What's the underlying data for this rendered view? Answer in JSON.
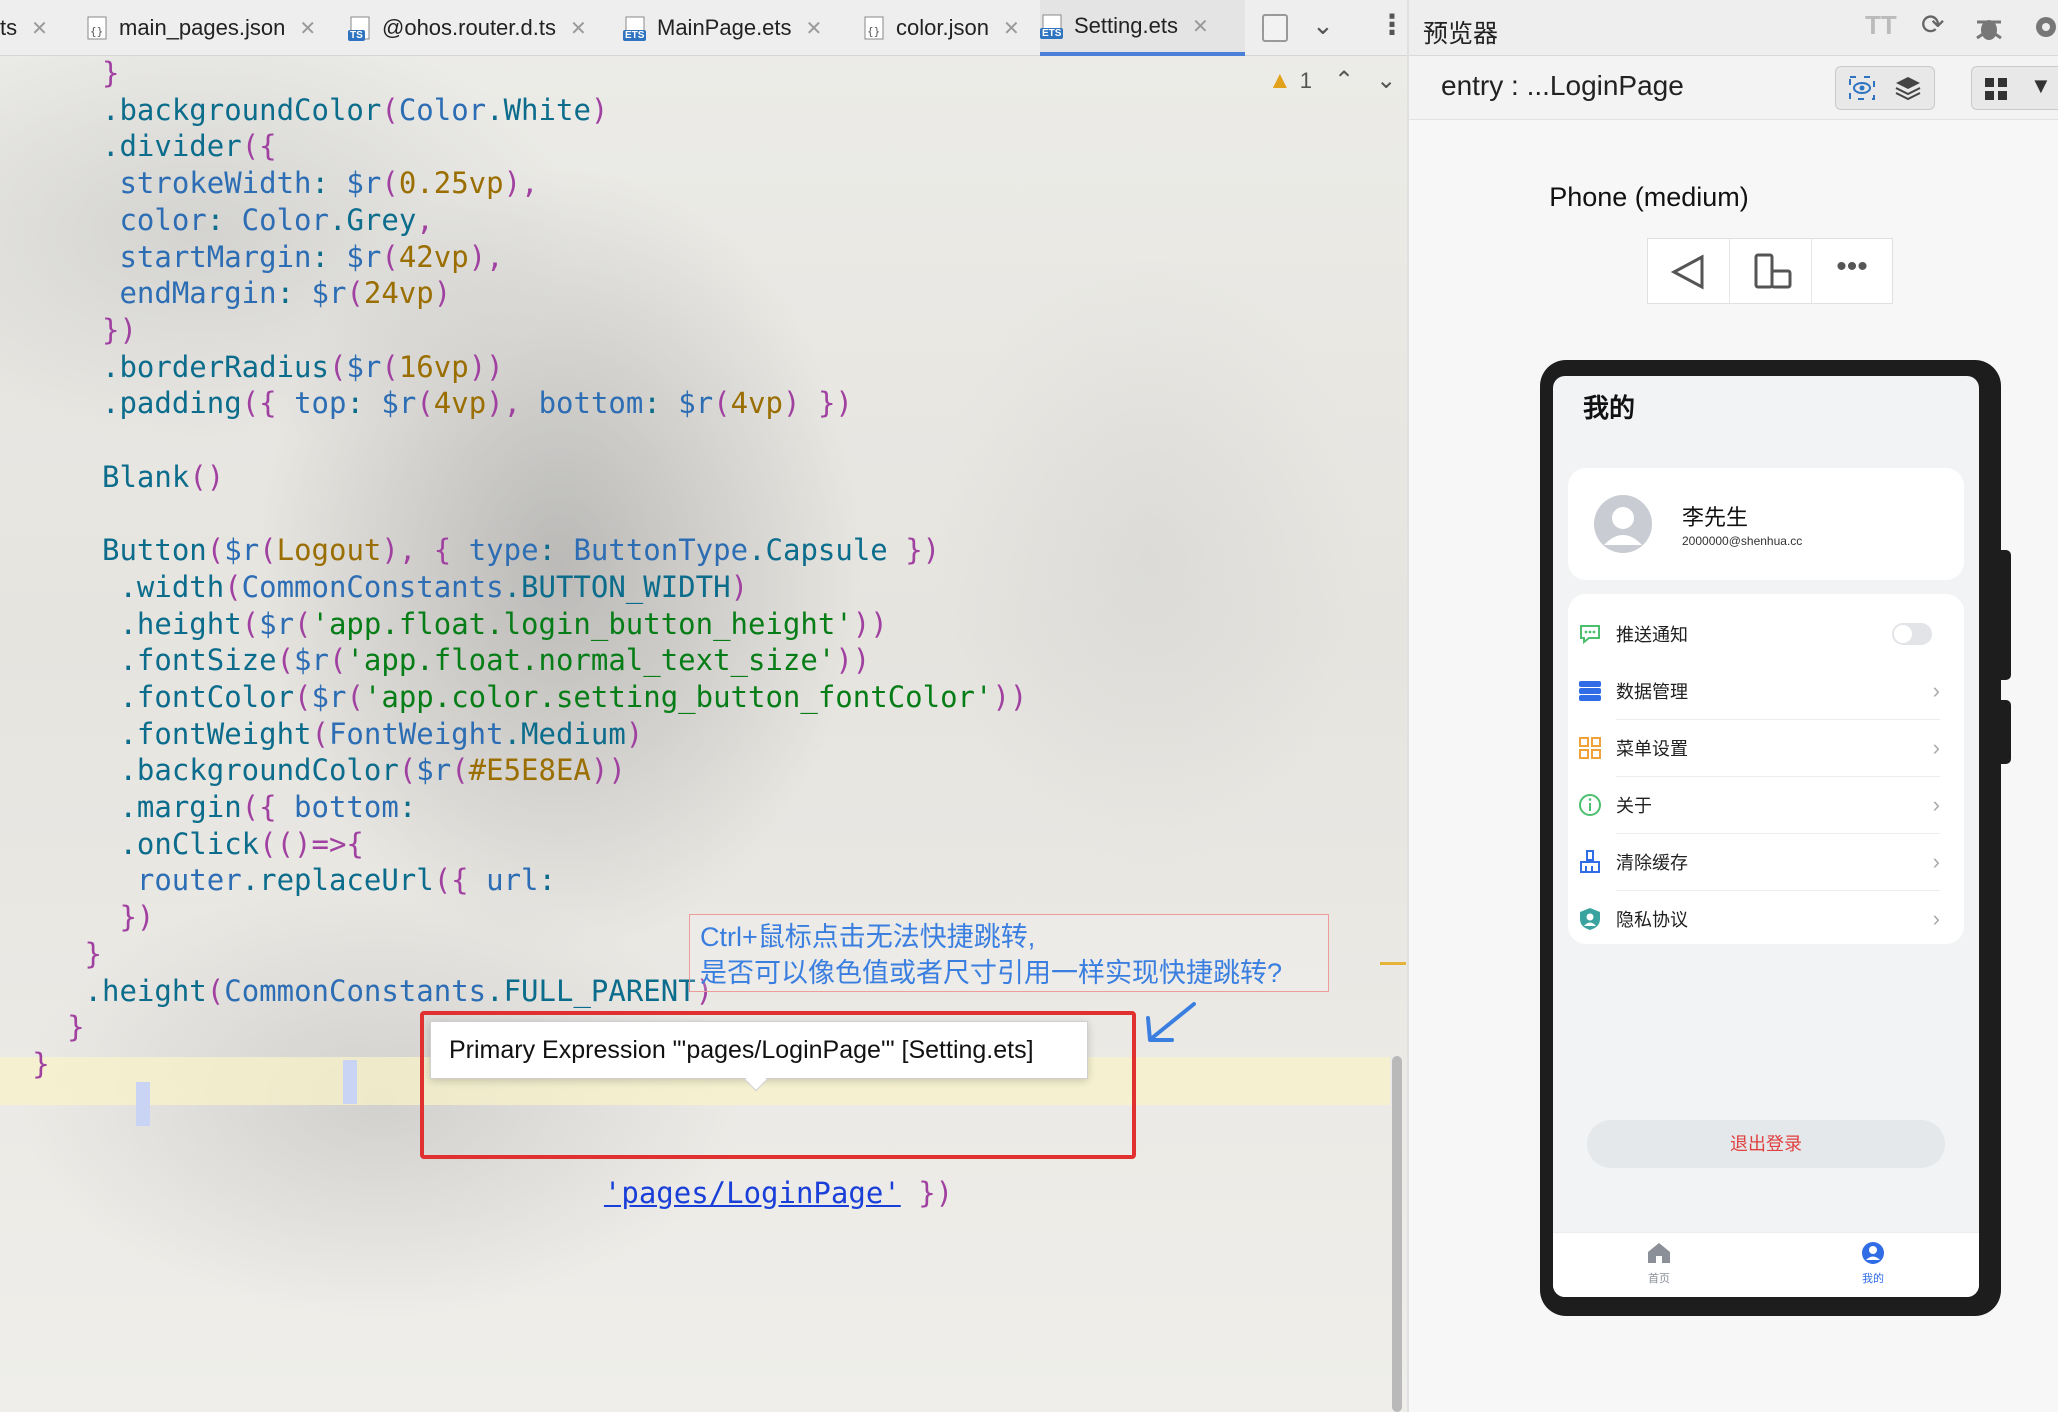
{
  "tabs": [
    {
      "label": "ts",
      "icon": "none"
    },
    {
      "label": "main_pages.json",
      "icon": "json-file-icon"
    },
    {
      "label": "@ohos.router.d.ts",
      "icon": "ts-file-icon"
    },
    {
      "label": "MainPage.ets",
      "icon": "ets-file-icon"
    },
    {
      "label": "color.json",
      "icon": "json-file-icon"
    },
    {
      "label": "Setting.ets",
      "icon": "ets-file-icon"
    }
  ],
  "tab_badges": {
    "ts": "TS",
    "ets": "ETS"
  },
  "editor": {
    "warning_count": "1",
    "lines": [
      {
        "indent": "    ",
        "parts": [
          [
            "o",
            "}"
          ]
        ]
      },
      {
        "indent": "    ",
        "parts": [
          [
            "m",
            ".backgroundColor"
          ],
          [
            "o",
            "("
          ],
          [
            "k",
            "Color"
          ],
          [
            "m",
            ".White"
          ],
          [
            "o",
            ")"
          ]
        ]
      },
      {
        "indent": "    ",
        "parts": [
          [
            "m",
            ".divider"
          ],
          [
            "o",
            "({"
          ]
        ]
      },
      {
        "indent": "     ",
        "parts": [
          [
            "k",
            "strokeWidth"
          ],
          [
            "m",
            ": "
          ],
          [
            "k",
            "$r"
          ],
          [
            "o",
            "("
          ],
          [
            "g",
            "0.25vp"
          ],
          [
            "o",
            "),"
          ]
        ]
      },
      {
        "indent": "     ",
        "parts": [
          [
            "k",
            "color"
          ],
          [
            "m",
            ": "
          ],
          [
            "k",
            "Color"
          ],
          [
            "m",
            ".Grey"
          ],
          [
            "o",
            ","
          ]
        ]
      },
      {
        "indent": "     ",
        "parts": [
          [
            "k",
            "startMargin"
          ],
          [
            "m",
            ": "
          ],
          [
            "k",
            "$r"
          ],
          [
            "o",
            "("
          ],
          [
            "g",
            "42vp"
          ],
          [
            "o",
            "),"
          ]
        ]
      },
      {
        "indent": "     ",
        "parts": [
          [
            "k",
            "endMargin"
          ],
          [
            "m",
            ": "
          ],
          [
            "k",
            "$r"
          ],
          [
            "o",
            "("
          ],
          [
            "g",
            "24vp"
          ],
          [
            "o",
            ")"
          ]
        ]
      },
      {
        "indent": "    ",
        "parts": [
          [
            "o",
            "})"
          ]
        ]
      },
      {
        "indent": "    ",
        "parts": [
          [
            "m",
            ".borderRadius"
          ],
          [
            "o",
            "("
          ],
          [
            "k",
            "$r"
          ],
          [
            "o",
            "("
          ],
          [
            "g",
            "16vp"
          ],
          [
            "o",
            "))"
          ]
        ]
      },
      {
        "indent": "    ",
        "parts": [
          [
            "m",
            ".padding"
          ],
          [
            "o",
            "({ "
          ],
          [
            "k",
            "top"
          ],
          [
            "m",
            ": "
          ],
          [
            "k",
            "$r"
          ],
          [
            "o",
            "("
          ],
          [
            "g",
            "4vp"
          ],
          [
            "o",
            "), "
          ],
          [
            "k",
            "bottom"
          ],
          [
            "m",
            ": "
          ],
          [
            "k",
            "$r"
          ],
          [
            "o",
            "("
          ],
          [
            "g",
            "4vp"
          ],
          [
            "o",
            ") })"
          ]
        ]
      },
      {
        "indent": "",
        "parts": []
      },
      {
        "indent": "    ",
        "parts": [
          [
            "m",
            "Blank"
          ],
          [
            "o",
            "()"
          ]
        ]
      },
      {
        "indent": "",
        "parts": []
      },
      {
        "indent": "    ",
        "parts": [
          [
            "m",
            "Button"
          ],
          [
            "o",
            "("
          ],
          [
            "k",
            "$r"
          ],
          [
            "o",
            "("
          ],
          [
            "g",
            "Logout"
          ],
          [
            "o",
            "), { "
          ],
          [
            "k",
            "type"
          ],
          [
            "m",
            ": "
          ],
          [
            "k",
            "ButtonType"
          ],
          [
            "m",
            ".Capsule"
          ],
          [
            "o",
            " })"
          ]
        ]
      },
      {
        "indent": "     ",
        "parts": [
          [
            "m",
            ".width"
          ],
          [
            "o",
            "("
          ],
          [
            "k",
            "CommonConstants"
          ],
          [
            "m",
            ".BUTTON_WIDTH"
          ],
          [
            "o",
            ")"
          ]
        ]
      },
      {
        "indent": "     ",
        "parts": [
          [
            "m",
            ".height"
          ],
          [
            "o",
            "("
          ],
          [
            "k",
            "$r"
          ],
          [
            "o",
            "("
          ],
          [
            "s",
            "'app.float.login_button_height'"
          ],
          [
            "o",
            "))"
          ]
        ]
      },
      {
        "indent": "     ",
        "parts": [
          [
            "m",
            ".fontSize"
          ],
          [
            "o",
            "("
          ],
          [
            "k",
            "$r"
          ],
          [
            "o",
            "("
          ],
          [
            "s",
            "'app.float.normal_text_size'"
          ],
          [
            "o",
            "))"
          ]
        ]
      },
      {
        "indent": "     ",
        "parts": [
          [
            "m",
            ".fontColor"
          ],
          [
            "o",
            "("
          ],
          [
            "k",
            "$r"
          ],
          [
            "o",
            "("
          ],
          [
            "s",
            "'app.color.setting_button_fontColor'"
          ],
          [
            "o",
            "))"
          ]
        ]
      },
      {
        "indent": "     ",
        "parts": [
          [
            "m",
            ".fontWeight"
          ],
          [
            "o",
            "("
          ],
          [
            "k",
            "FontWeight"
          ],
          [
            "m",
            ".Medium"
          ],
          [
            "o",
            ")"
          ]
        ]
      },
      {
        "indent": "     ",
        "parts": [
          [
            "m",
            ".backgroundColor"
          ],
          [
            "o",
            "("
          ],
          [
            "k",
            "$r"
          ],
          [
            "o",
            "("
          ],
          [
            "g",
            "#E5E8EA"
          ],
          [
            "o",
            "))"
          ]
        ]
      },
      {
        "indent": "     ",
        "parts": [
          [
            "m",
            ".margin"
          ],
          [
            "o",
            "({ "
          ],
          [
            "k",
            "bottom"
          ],
          [
            "m",
            ": "
          ]
        ]
      },
      {
        "indent": "     ",
        "parts": [
          [
            "m",
            ".onClick"
          ],
          [
            "o",
            "(()=>{"
          ]
        ]
      },
      {
        "indent": "      ",
        "parts": [
          [
            "k",
            "router"
          ],
          [
            "m",
            ".replaceUrl"
          ],
          [
            "o",
            "({ "
          ],
          [
            "k",
            "url"
          ],
          [
            "m",
            ": "
          ]
        ]
      },
      {
        "indent": "     ",
        "parts": [
          [
            "o",
            "})"
          ]
        ]
      },
      {
        "indent": "   ",
        "parts": [
          [
            "o",
            "}"
          ]
        ]
      },
      {
        "indent": "   ",
        "parts": [
          [
            "m",
            ".height"
          ],
          [
            "o",
            "("
          ],
          [
            "k",
            "CommonConstants"
          ],
          [
            "m",
            ".FULL_PARENT"
          ],
          [
            "o",
            ")"
          ]
        ]
      },
      {
        "indent": "  ",
        "parts": [
          [
            "o",
            "}"
          ]
        ]
      },
      {
        "indent": "",
        "parts": [
          [
            "o",
            "}"
          ]
        ]
      }
    ],
    "url_link": "'pages/LoginPage'",
    "url_close": " })",
    "tooltip": "Primary Expression \"'pages/LoginPage'\" [Setting.ets]",
    "annotation_line1": "Ctrl+鼠标点击无法快捷跳转,",
    "annotation_line2": "是否可以像色值或者尺寸引用一样实现快捷跳转?"
  },
  "preview": {
    "title": "预览器",
    "path": "entry : ...LoginPage",
    "device": "Phone (medium)",
    "app": {
      "header": "我的",
      "user_name": "李先生",
      "user_email": "2000000@shenhua.cc",
      "menu": [
        {
          "label": "推送通知",
          "icon": "chat-bubble-icon",
          "color": "#4cbf6e",
          "kind": "toggle"
        },
        {
          "label": "数据管理",
          "icon": "database-icon",
          "color": "#2f6ce5",
          "kind": "chevron"
        },
        {
          "label": "菜单设置",
          "icon": "grid-icon",
          "color": "#f0a23a",
          "kind": "chevron"
        },
        {
          "label": "关于",
          "icon": "info-icon",
          "color": "#4cbf6e",
          "kind": "chevron"
        },
        {
          "label": "清除缓存",
          "icon": "brush-icon",
          "color": "#2f6ce5",
          "kind": "chevron"
        },
        {
          "label": "隐私协议",
          "icon": "shield-icon",
          "color": "#3aa3a0",
          "kind": "chevron"
        }
      ],
      "logout": "退出登录",
      "logout_color": "#e04040",
      "nav": [
        {
          "label": "首页"
        },
        {
          "label": "我的"
        }
      ],
      "nav_active_color": "#2f6ce5"
    }
  }
}
